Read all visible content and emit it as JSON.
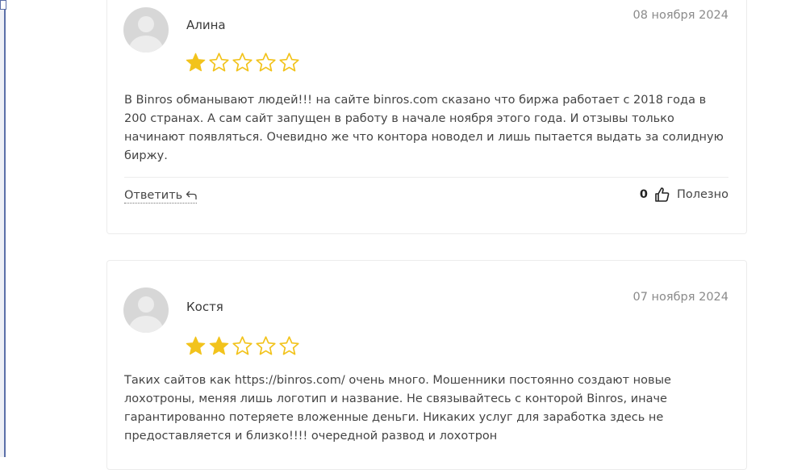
{
  "reviews": [
    {
      "author": "Алина",
      "date": "08 ноября 2024",
      "rating": 1,
      "rating_max": 5,
      "text": "В Binros обманывают людей!!! на сайте binros.com сказано что биржа работает с 2018 года в 200 странах. А сам сайт запущен в работу в начале ноября этого года. И отзывы только начинают появляться. Очевидно же что контора новодел и лишь пытается выдать за солидную биржу.",
      "reply_label": "Ответить",
      "likes": "0",
      "helpful_label": "Полезно"
    },
    {
      "author": "Костя",
      "date": "07 ноября 2024",
      "rating": 2,
      "rating_max": 5,
      "text": "Таких сайтов как https://binros.com/ очень много. Мошенники постоянно создают новые лохотроны, меняя лишь логотип и название. Не связывайтесь с конторой Binros, иначе гарантированно потеряете вложенные деньги. Никаких услуг для заработка здесь не предоставляется и близко!!!! очередной развод и лохотрон"
    }
  ],
  "colors": {
    "star_filled": "#f2c31c",
    "star_empty_stroke": "#f2c31c"
  },
  "icons": {
    "reply": "reply-arrow-icon",
    "like": "thumbs-up-icon",
    "avatar": "user-avatar-icon",
    "star": "star-icon"
  }
}
